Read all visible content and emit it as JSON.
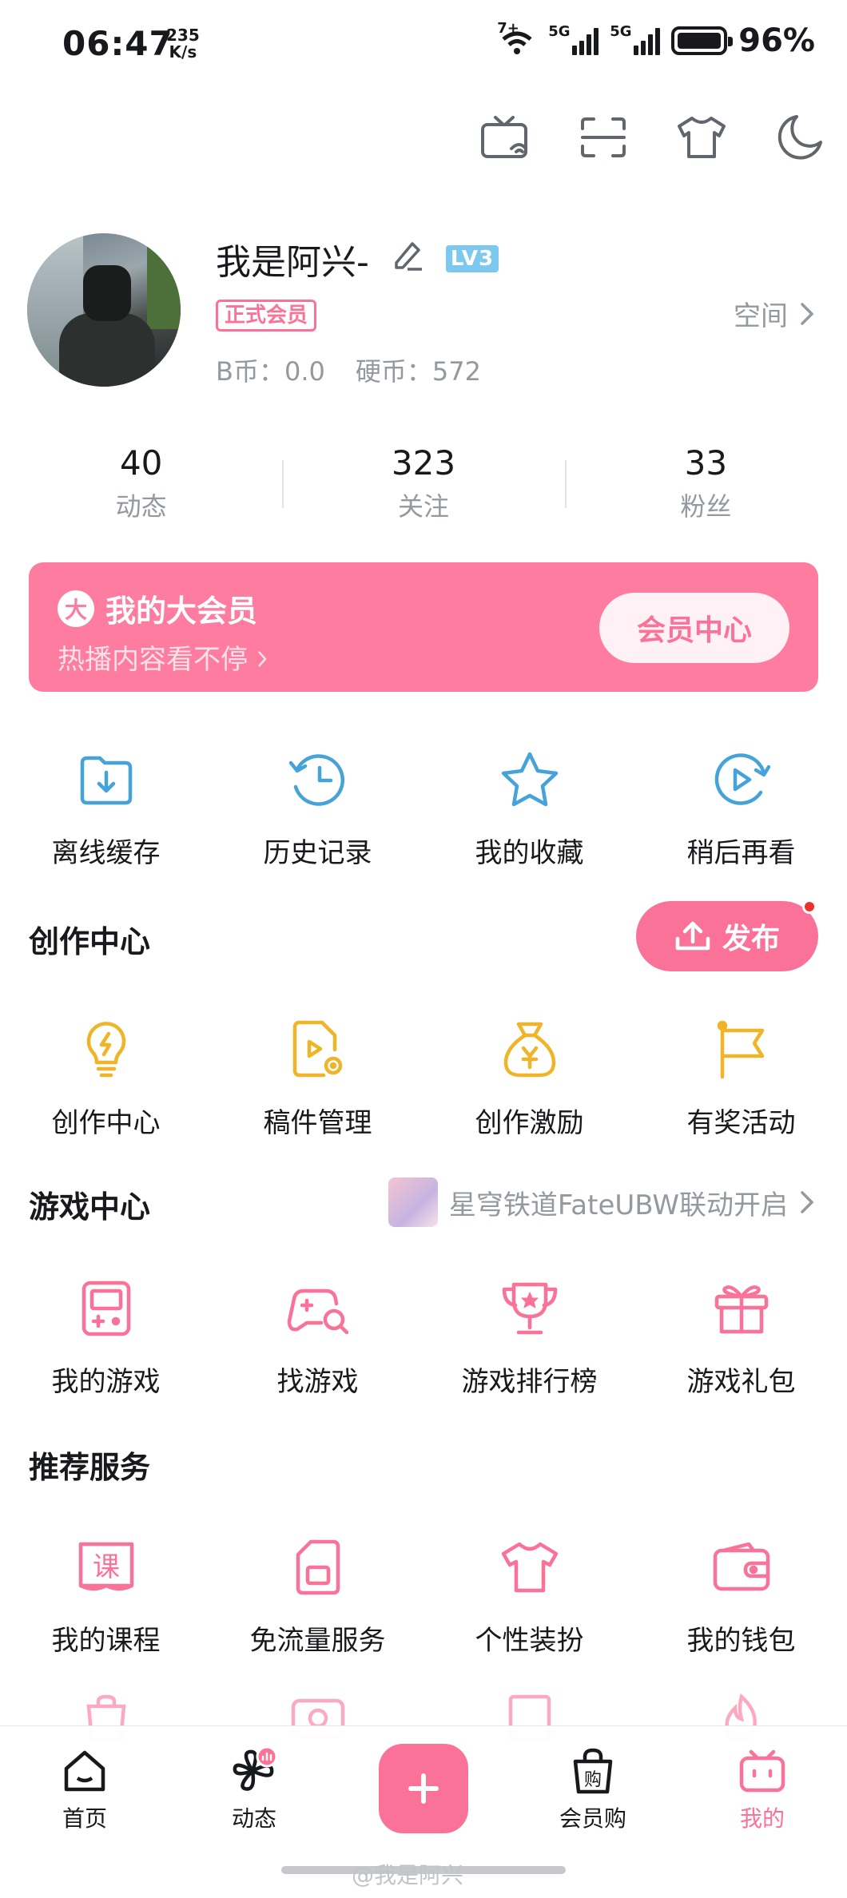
{
  "status_bar": {
    "time": "06:47",
    "speed_value": "235",
    "speed_unit": "K/s",
    "wifi_label": "7+",
    "sim1": "5G",
    "sim2": "5G",
    "battery": "96%"
  },
  "top_icons": [
    "tv-icon",
    "scan-icon",
    "outfit-icon",
    "night-mode-icon"
  ],
  "profile": {
    "name": "我是阿兴-",
    "level": "LV3",
    "vip_badge": "正式会员",
    "bcoin": "B币：0.0",
    "coin": "硬币：572",
    "space": "空间"
  },
  "stats": [
    {
      "value": "40",
      "label": "动态"
    },
    {
      "value": "323",
      "label": "关注"
    },
    {
      "value": "33",
      "label": "粉丝"
    }
  ],
  "vip_card": {
    "icon_text": "大",
    "title": "我的大会员",
    "subtitle": "热播内容看不停",
    "button": "会员中心"
  },
  "quick": [
    {
      "label": "离线缓存",
      "icon": "offline-cache-icon"
    },
    {
      "label": "历史记录",
      "icon": "history-icon"
    },
    {
      "label": "我的收藏",
      "icon": "favorite-icon"
    },
    {
      "label": "稍后再看",
      "icon": "watch-later-icon"
    }
  ],
  "create": {
    "title": "创作中心",
    "publish": "发布",
    "items": [
      {
        "label": "创作中心",
        "icon": "bulb-icon"
      },
      {
        "label": "稿件管理",
        "icon": "manuscript-icon"
      },
      {
        "label": "创作激励",
        "icon": "money-bag-icon"
      },
      {
        "label": "有奖活动",
        "icon": "flag-icon"
      }
    ]
  },
  "game": {
    "title": "游戏中心",
    "promo": "星穹铁道FateUBW联动开启",
    "items": [
      {
        "label": "我的游戏",
        "icon": "gameboy-icon"
      },
      {
        "label": "找游戏",
        "icon": "gamepad-search-icon"
      },
      {
        "label": "游戏排行榜",
        "icon": "trophy-icon"
      },
      {
        "label": "游戏礼包",
        "icon": "gift-icon"
      }
    ]
  },
  "services": {
    "title": "推荐服务",
    "items": [
      {
        "label": "我的课程",
        "icon": "course-icon"
      },
      {
        "label": "免流量服务",
        "icon": "sim-card-icon"
      },
      {
        "label": "个性装扮",
        "icon": "tshirt-icon"
      },
      {
        "label": "我的钱包",
        "icon": "wallet-icon"
      }
    ]
  },
  "bottom_nav": [
    {
      "label": "首页",
      "icon": "home-icon"
    },
    {
      "label": "动态",
      "icon": "dynamic-icon"
    },
    {
      "label": "",
      "icon": "plus-icon"
    },
    {
      "label": "会员购",
      "icon": "shop-bag-icon"
    },
    {
      "label": "我的",
      "icon": "tv-face-icon"
    }
  ],
  "watermark": "@我是阿兴",
  "colors": {
    "brand_pink": "#fb7299",
    "vip_card": "#fe7ca0",
    "blue_icon": "#46a3d9",
    "yellow_icon": "#f0b429",
    "gray_text": "#9499a0"
  }
}
